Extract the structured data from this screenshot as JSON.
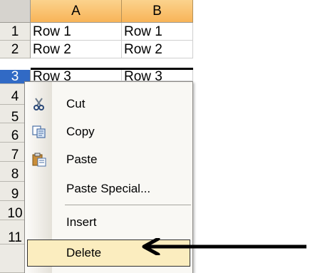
{
  "sheet": {
    "columns": [
      "A",
      "B"
    ],
    "rows": [
      {
        "num": "1",
        "cells": [
          "Row 1",
          "Row 1"
        ]
      },
      {
        "num": "2",
        "cells": [
          "Row 2",
          "Row 2"
        ]
      },
      {
        "num": "3",
        "cells": [
          "Row 3",
          "Row 3"
        ]
      },
      {
        "num": "4"
      },
      {
        "num": "5"
      },
      {
        "num": "6"
      },
      {
        "num": "7"
      },
      {
        "num": "8"
      },
      {
        "num": "9"
      },
      {
        "num": "10"
      },
      {
        "num": "11"
      }
    ],
    "selected_row": "3"
  },
  "context_menu": {
    "items": [
      {
        "label": "Cut",
        "icon": "scissors-icon"
      },
      {
        "label": "Copy",
        "icon": "copy-icon"
      },
      {
        "label": "Paste",
        "icon": "paste-icon"
      },
      {
        "label": "Paste Special..."
      },
      {
        "label": "Insert"
      },
      {
        "label": "Delete",
        "highlighted": true
      }
    ]
  },
  "colors": {
    "column_header": "#f8b458",
    "selected_row": "#316ac5",
    "menu_highlight": "#fbedbf",
    "arrow": "#000000"
  }
}
